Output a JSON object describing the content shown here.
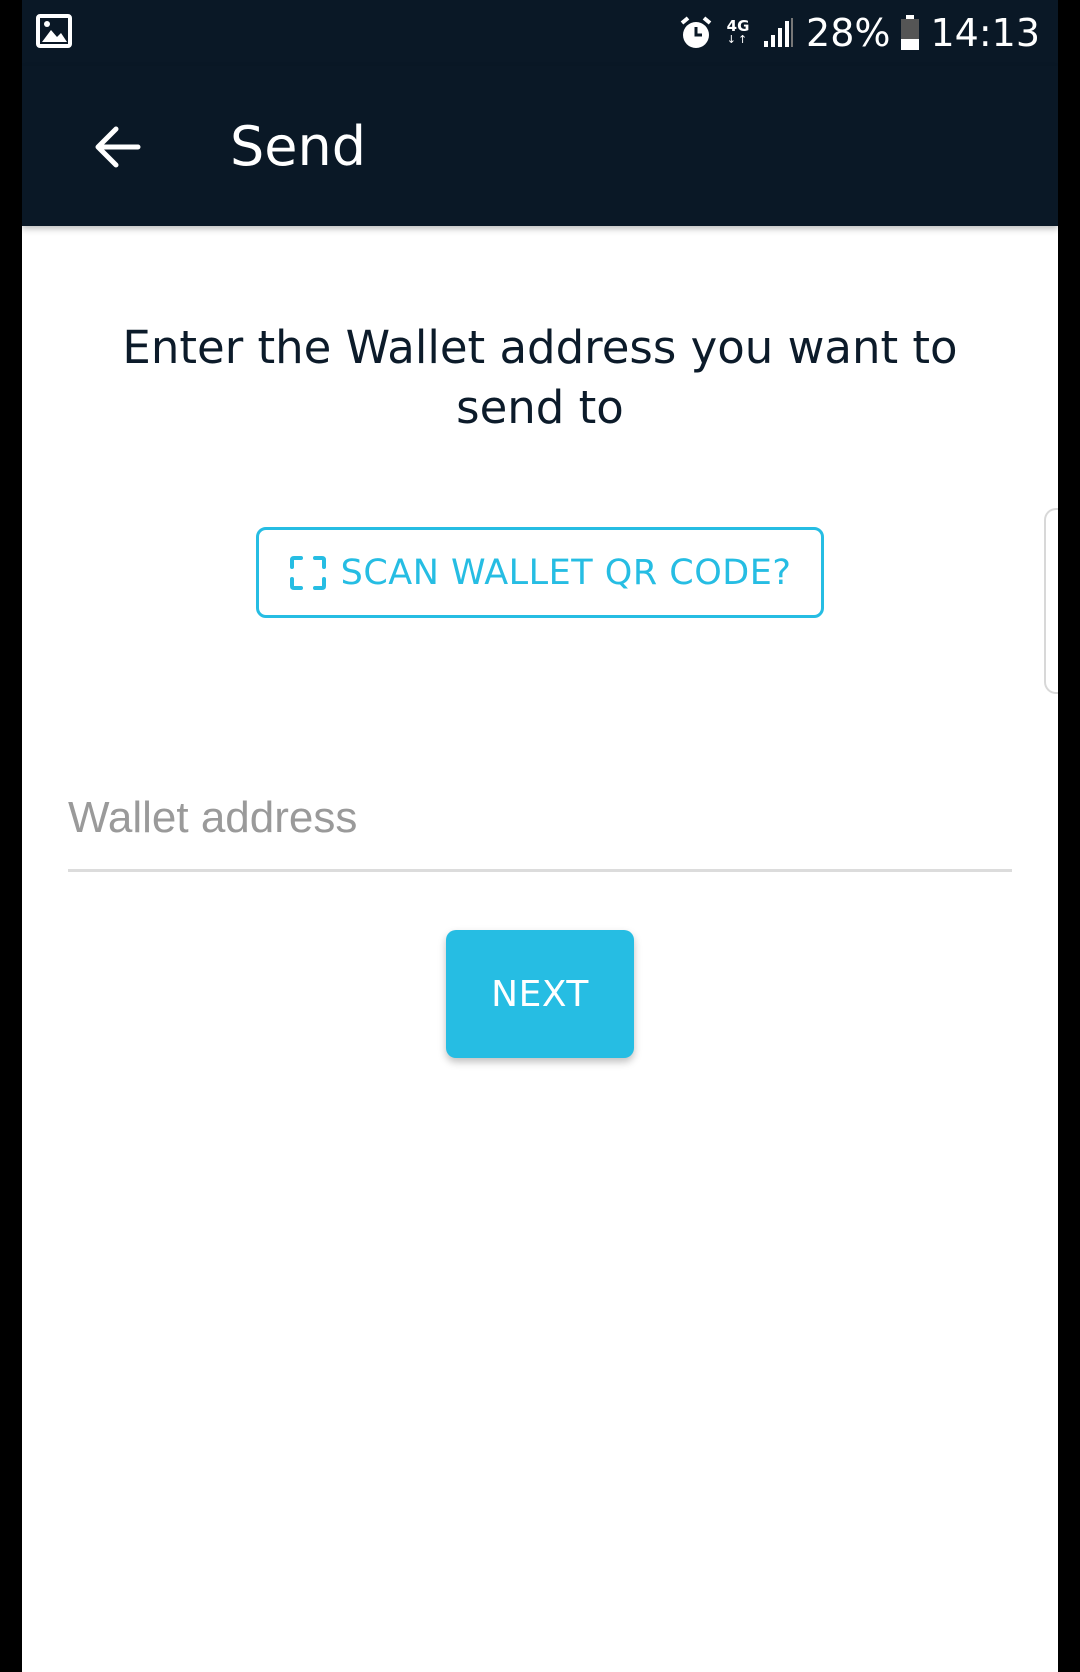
{
  "status_bar": {
    "network": "4G",
    "battery": "28%",
    "time": "14:13"
  },
  "app_bar": {
    "title": "Send"
  },
  "main": {
    "prompt": "Enter the Wallet address you want to send to",
    "scan_button_label": "SCAN WALLET QR CODE?",
    "wallet_input": {
      "placeholder": "Wallet address",
      "value": ""
    },
    "next_button_label": "NEXT"
  },
  "colors": {
    "app_bar": "#0a1826",
    "accent": "#26bde3",
    "text_dark": "#0c1b2a",
    "placeholder": "#9a9a9a"
  },
  "icons": {
    "status_left": "gallery-icon",
    "status_right": [
      "alarm-icon",
      "signal-icon",
      "battery-icon"
    ],
    "app_bar": "back-arrow-icon",
    "scan": "qr-scan-icon"
  }
}
